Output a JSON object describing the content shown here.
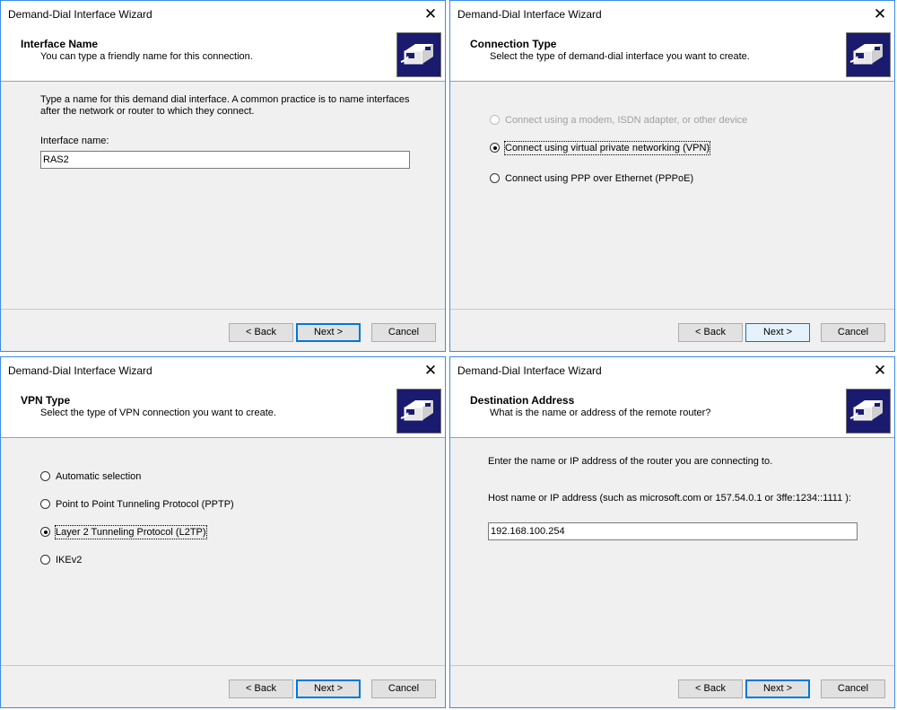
{
  "dialogs": [
    {
      "title": "Demand-Dial Interface Wizard",
      "header_title": "Interface Name",
      "header_subtitle": "You can type a friendly name for this connection.",
      "instructions": [
        "Type a name for this demand dial interface.  A common practice is to name interfaces",
        "after the network or router to which they connect."
      ],
      "field_label": "Interface name:",
      "field_value": "RAS2",
      "buttons": {
        "back": "< Back",
        "next": "Next >",
        "cancel": "Cancel"
      }
    },
    {
      "title": "Demand-Dial Interface Wizard",
      "header_title": "Connection Type",
      "header_subtitle": "Select the type of demand-dial interface you want to create.",
      "options": [
        {
          "label": "Connect using a modem, ISDN adapter, or other device",
          "selected": false,
          "enabled": false
        },
        {
          "label": "Connect using virtual private networking (VPN)",
          "selected": true,
          "enabled": true
        },
        {
          "label": "Connect using PPP over Ethernet (PPPoE)",
          "selected": false,
          "enabled": true
        }
      ],
      "buttons": {
        "back": "< Back",
        "next": "Next >",
        "cancel": "Cancel"
      }
    },
    {
      "title": "Demand-Dial Interface Wizard",
      "header_title": "VPN Type",
      "header_subtitle": "Select the type of VPN connection you want to create.",
      "options": [
        {
          "label": "Automatic selection",
          "selected": false,
          "enabled": true
        },
        {
          "label": "Point to Point Tunneling Protocol (PPTP)",
          "selected": false,
          "enabled": true
        },
        {
          "label": "Layer 2 Tunneling Protocol (L2TP)",
          "selected": true,
          "enabled": true
        },
        {
          "label": "IKEv2",
          "selected": false,
          "enabled": true
        }
      ],
      "buttons": {
        "back": "< Back",
        "next": "Next >",
        "cancel": "Cancel"
      }
    },
    {
      "title": "Demand-Dial Interface Wizard",
      "header_title": "Destination Address",
      "header_subtitle": "What is the name or address of the remote router?",
      "instruction": "Enter the name or IP address of the router you are connecting to.",
      "field_label": "Host name or IP address (such as microsoft.com or 157.54.0.1 or 3ffe:1234::1111 ):",
      "field_value": "192.168.100.254",
      "buttons": {
        "back": "< Back",
        "next": "Next >",
        "cancel": "Cancel"
      }
    }
  ],
  "icons": {
    "close": "close-icon",
    "wizard": "network-wizard-icon"
  },
  "colors": {
    "accent": "#0078d7",
    "window_border": "#3c8ce6",
    "icon_bg": "#1a1a6e"
  }
}
